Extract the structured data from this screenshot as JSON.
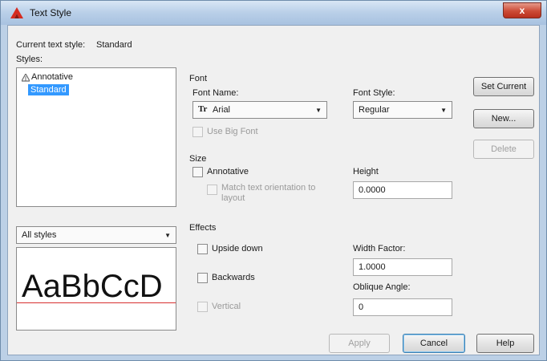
{
  "window": {
    "title": "Text Style",
    "close_glyph": "x"
  },
  "current_style": {
    "label": "Current text style:",
    "value": "Standard"
  },
  "styles": {
    "label": "Styles:",
    "items": [
      {
        "label": "Annotative",
        "icon": "annotative-scale-icon"
      },
      {
        "label": "Standard",
        "selected": true
      }
    ],
    "filter_value": "All styles"
  },
  "preview": {
    "text": "AaBbCcD"
  },
  "font": {
    "group_label": "Font",
    "font_name_label": "Font Name:",
    "font_name_value": "Arial",
    "font_name_icon": "truetype-icon",
    "font_style_label": "Font Style:",
    "font_style_value": "Regular",
    "big_font_label": "Use Big Font"
  },
  "size": {
    "group_label": "Size",
    "annotative_label": "Annotative",
    "match_orientation_label": "Match text orientation to layout",
    "height_label": "Height",
    "height_value": "0.0000"
  },
  "effects": {
    "group_label": "Effects",
    "upside_down_label": "Upside down",
    "backwards_label": "Backwards",
    "vertical_label": "Vertical",
    "width_factor_label": "Width Factor:",
    "width_factor_value": "1.0000",
    "oblique_angle_label": "Oblique Angle:",
    "oblique_angle_value": "0"
  },
  "buttons": {
    "set_current": "Set Current",
    "new": "New...",
    "delete": "Delete",
    "apply": "Apply",
    "cancel": "Cancel",
    "help": "Help"
  },
  "colors": {
    "accent": "#3399ff",
    "baseline": "#d83030",
    "title_icon": "#d62b1f"
  }
}
